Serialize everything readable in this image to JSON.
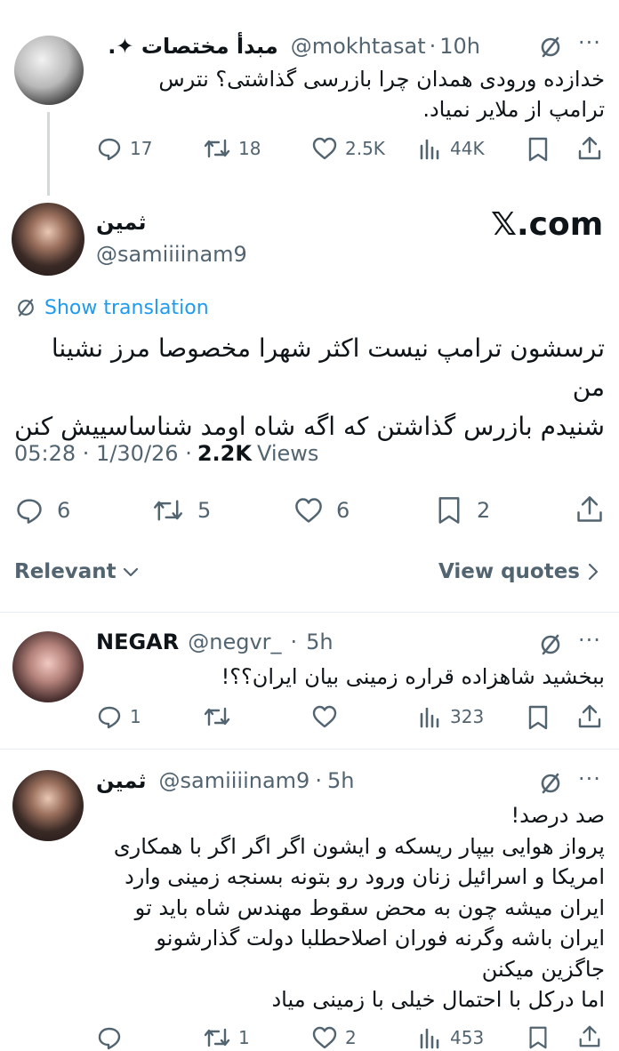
{
  "tweet1": {
    "name": "مبدأ مختصات ✦.",
    "handle": "@mokhtasat",
    "time": "10h",
    "text_line1": "خدازده ورودی همدان چرا بازرسی گذاشتی؟ نترس",
    "text_line2": "ترامپ از ملایر نمیاد.",
    "replies": "17",
    "retweets": "18",
    "likes": "2.5K",
    "views": "44K"
  },
  "main": {
    "name": "ثمین",
    "handle": "@samiiiinam9",
    "watermark": "𝕏.com",
    "show_translation": "Show translation",
    "text_line1": "ترسشون ترامپ نیست اکثر شهرا مخصوصا مرز نشینا من",
    "text_line2": "شنیدم بازرس گذاشتن که اگه شاه اومد شناساسییش کنن",
    "time": "05:28 · 1/30/26 ·",
    "views_count": "2.2K",
    "views_label": "Views",
    "replies": "6",
    "retweets": "5",
    "likes": "6",
    "bookmarks": "2"
  },
  "filters": {
    "relevant": "Relevant",
    "view_quotes": "View quotes"
  },
  "reply1": {
    "name": "NEGAR",
    "handle": "@negvr_",
    "time": "5h",
    "text": "ببخشید شاهزاده قراره زمینی بیان ایران؟؟!",
    "replies": "1",
    "retweets": "",
    "likes": "",
    "views": "323"
  },
  "reply2": {
    "name": "ثمین",
    "handle": "@samiiiinam9",
    "time": "5h",
    "lines": [
      "صد درصد!",
      "پرواز هوایی بیپار ریسکه و ایشون اگر اگر اگر با همکاری",
      "امریکا و اسرائیل زنان ورود رو بتونه بسنجه زمینی وارد",
      "ایران میشه چون به محض سقوط مهندس شاه باید تو",
      "ایران باشه وگرنه فوران اصلاحطلبا دولت گذارشونو",
      "جاگزین میکنن",
      "اما درکل با احتمال خیلی با زمینی میاد"
    ],
    "replies": "",
    "retweets": "1",
    "likes": "2",
    "views": "453"
  },
  "colors": {
    "text": "#0f1419",
    "secondary": "#536471",
    "accent": "#1d9bf0",
    "thread_line": "#cfd9de"
  }
}
